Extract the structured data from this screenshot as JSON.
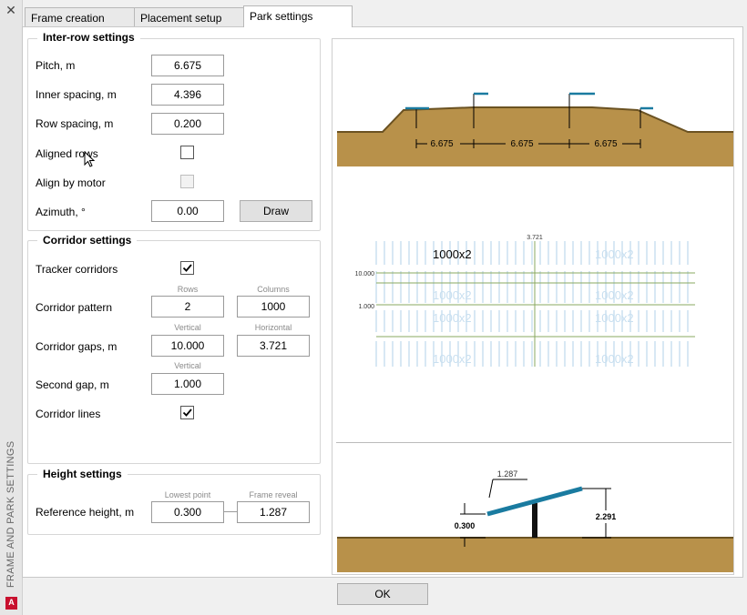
{
  "window": {
    "close_glyph": "✕",
    "side_title": "FRAME AND PARK SETTINGS",
    "logo_letter": "A"
  },
  "tabs": [
    "Frame creation",
    "Placement setup",
    "Park settings"
  ],
  "inter_row": {
    "title": "Inter-row settings",
    "pitch_label": "Pitch, m",
    "pitch_value": "6.675",
    "inner_label": "Inner spacing, m",
    "inner_value": "4.396",
    "row_label": "Row spacing, m",
    "row_value": "0.200",
    "aligned_label": "Aligned rows",
    "aligned_checked": false,
    "motor_label": "Align by motor",
    "motor_checked": false,
    "azimuth_label": "Azimuth, °",
    "azimuth_value": "0.00",
    "draw_label": "Draw"
  },
  "corridor": {
    "title": "Corridor settings",
    "tracker_label": "Tracker corridors",
    "tracker_checked": true,
    "rows_sub": "Rows",
    "columns_sub": "Columns",
    "pattern_label": "Corridor pattern",
    "pattern_rows": "2",
    "pattern_columns": "1000",
    "vertical_sub": "Vertical",
    "horizontal_sub": "Horizontal",
    "gaps_label": "Corridor gaps, m",
    "gaps_vertical": "10.000",
    "gaps_horizontal": "3.721",
    "second_sub": "Vertical",
    "second_label": "Second gap, m",
    "second_value": "1.000",
    "lines_label": "Corridor lines",
    "lines_checked": true
  },
  "height": {
    "title": "Height settings",
    "lowest_sub": "Lowest point",
    "reveal_sub": "Frame reveal",
    "ref_label": "Reference height, m",
    "ref_lowest": "0.300",
    "ref_reveal": "1.287"
  },
  "preview": {
    "section_dims": [
      "6.675",
      "6.675",
      "6.675"
    ],
    "plan_label": "1000x2",
    "plan_top_dim": "3.721",
    "plan_left_dim1": "10.000",
    "plan_left_dim2": "1.000",
    "tracker_top": "1.287",
    "tracker_left": "0.300",
    "tracker_right": "2.291"
  },
  "ok_label": "OK",
  "colors": {
    "soil": "#b8914a",
    "soil_line": "#6b5222",
    "panel_blue": "#1a7ba0",
    "plan_line": "#c8dff0",
    "corridor_line": "#8aa860"
  }
}
